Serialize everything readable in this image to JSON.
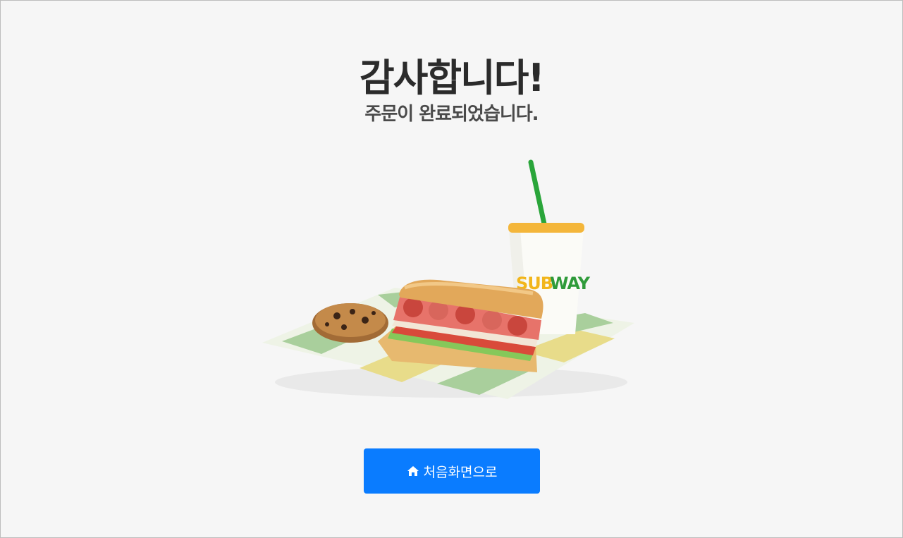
{
  "page": {
    "title": "감사합니다!",
    "subtitle": "주문이 완료되었습니다."
  },
  "illustration": {
    "cup_logo": "SUBWAY",
    "icon": "meal-combo-image"
  },
  "home_button": {
    "label": "처음화면으로",
    "icon": "home-icon",
    "color": "#0a7cff"
  }
}
